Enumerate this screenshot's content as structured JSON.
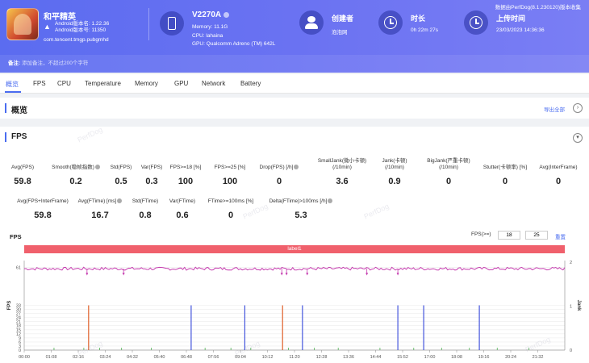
{
  "header": {
    "game_name": "和平精英",
    "android_version_line": "Android版本名: 1.22.36",
    "android_code_line": "Android版本号: 11350",
    "package": "com.tencent.tmgp.pubgmhd",
    "device_name": "V2270A",
    "memory_line": "Memory: 11.1G",
    "cpu_line": "CPU: lahaina",
    "gpu_line": "GPU: Qualcomm Adreno (TM) 642L",
    "creator_label": "创建者",
    "creator_value": "泡泡网",
    "duration_label": "时长",
    "duration_value": "0h 22m 27s",
    "upload_label": "上传时间",
    "upload_value": "23/03/2023 14:36:36",
    "top_note": "数据由PerfDog(8.1.230120)版本收集",
    "note_label": "备注:",
    "note_placeholder": "添加备注，不超过200个字符"
  },
  "tabs": [
    "概览",
    "FPS",
    "CPU",
    "Temperature",
    "Memory",
    "GPU",
    "Network",
    "Battery"
  ],
  "overview": {
    "title": "概览",
    "export": "导出全部"
  },
  "fps_section": {
    "title": "FPS",
    "collapse_icon": "chevron-down-icon",
    "row1": [
      {
        "label": "Avg(FPS)",
        "value": "59.8"
      },
      {
        "label": "Smooth(稳帧指数)",
        "value": "0.2",
        "help": true
      },
      {
        "label": "Std(FPS)",
        "value": "0.5"
      },
      {
        "label": "Var(FPS)",
        "value": "0.3"
      },
      {
        "label": "FPS>=18 [%]",
        "value": "100"
      },
      {
        "label": "FPS>=25 [%]",
        "value": "100"
      },
      {
        "label": "Drop(FPS) [/h]",
        "value": "0",
        "help": true
      },
      {
        "label": "SmallJank(微小卡顿)\n(/10min)",
        "value": "3.6"
      },
      {
        "label": "Jank(卡顿)\n(/10min)",
        "value": "0.9"
      },
      {
        "label": "BigJank(严重卡顿)\n(/10min)",
        "value": "0"
      },
      {
        "label": "Stutter(卡顿率) [%]",
        "value": "0"
      },
      {
        "label": "Avg(InterFrame)",
        "value": "0"
      }
    ],
    "row2": [
      {
        "label": "Avg(FPS+InterFrame)",
        "value": "59.8"
      },
      {
        "label": "Avg(FTime) [ms]",
        "value": "16.7",
        "help": true
      },
      {
        "label": "Std(FTime)",
        "value": "0.8"
      },
      {
        "label": "Var(FTime)",
        "value": "0.6"
      },
      {
        "label": "FTime>=100ms [%]",
        "value": "0"
      },
      {
        "label": "Delta(FTime)>100ms [/h]",
        "value": "5.3",
        "help": true
      }
    ],
    "chart_title": "FPS",
    "filter_label": "FPS(>=)",
    "filter_values": [
      "18",
      "25"
    ],
    "reset": "重置",
    "label_band": "label1",
    "watermark": "PerfDog"
  },
  "chart_data": {
    "type": "line",
    "title": "",
    "ylabel": "FPS",
    "y2label": "Jank",
    "x_ticks": [
      "00:00",
      "01:08",
      "02:16",
      "03:24",
      "04:32",
      "05:40",
      "06:48",
      "07:56",
      "09:04",
      "10:12",
      "11:20",
      "12:28",
      "13:36",
      "14:44",
      "15:52",
      "17:00",
      "18:08",
      "19:16",
      "20:24",
      "21:32"
    ],
    "y_ticks": [
      0,
      3,
      6,
      9,
      12,
      15,
      18,
      21,
      24,
      27,
      30,
      33,
      61
    ],
    "y2_ticks": [
      0,
      1,
      2
    ],
    "ylim": [
      0,
      66
    ],
    "fps_series": {
      "name": "FPS",
      "approx_value": 60,
      "color": "#c63fb0"
    },
    "small_jank_times": [
      "07:00",
      "09:15",
      "11:40",
      "15:40",
      "16:45",
      "19:05"
    ],
    "jank_times": [
      "02:42",
      "10:50"
    ],
    "small_jank_color": "#4455dd",
    "jank_color": "#e0602a",
    "dips": [
      "02:38",
      "04:10",
      "10:48",
      "11:00",
      "11:52",
      "14:22",
      "15:40"
    ],
    "grid": true
  }
}
